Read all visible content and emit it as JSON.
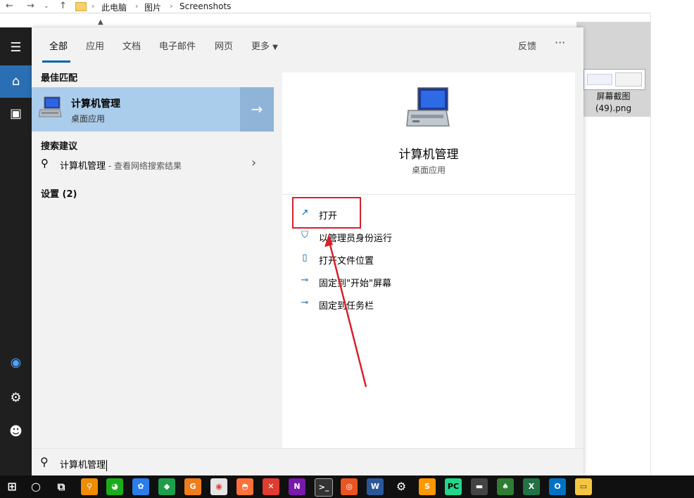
{
  "explorer": {
    "breadcrumb": [
      "此电脑",
      "图片",
      "Screenshots"
    ],
    "thumbnail_label": "屏幕截图\n(49).png"
  },
  "tabs": [
    "全部",
    "应用",
    "文档",
    "电子邮件",
    "网页",
    "更多"
  ],
  "header_right": {
    "feedback": "反馈",
    "more": "···"
  },
  "best_match": {
    "header": "最佳匹配",
    "title": "计算机管理",
    "subtitle": "桌面应用"
  },
  "suggestions": {
    "header": "搜索建议",
    "item_text": "计算机管理",
    "item_hint": " - 查看网络搜索结果"
  },
  "settings_header": "设置 (2)",
  "detail": {
    "title": "计算机管理",
    "subtitle": "桌面应用",
    "actions": [
      "打开",
      "以管理员身份运行",
      "打开文件位置",
      "固定到\"开始\"屏幕",
      "固定到任务栏"
    ]
  },
  "search": {
    "value": "计算机管理"
  },
  "colors": {
    "accent": "#0063b1",
    "best_match_bg": "#abcdec",
    "annotation": "#d9202b",
    "rail_bg": "#1f1f1f"
  },
  "taskbar_icons": [
    "start-icon",
    "cortana-icon",
    "task-view-icon",
    "search-app-icon",
    "wechat-icon",
    "app-blue-icon",
    "app-green-icon",
    "app-orange-icon",
    "chrome-icon",
    "firefox-icon",
    "xmind-icon",
    "onenote-icon",
    "cmd-icon",
    "ubuntu-icon",
    "word-icon",
    "settings-icon",
    "sublime-icon",
    "pycharm-icon",
    "terminal-icon",
    "solitaire-icon",
    "excel-icon",
    "outlook-icon",
    "file-explorer-icon"
  ]
}
